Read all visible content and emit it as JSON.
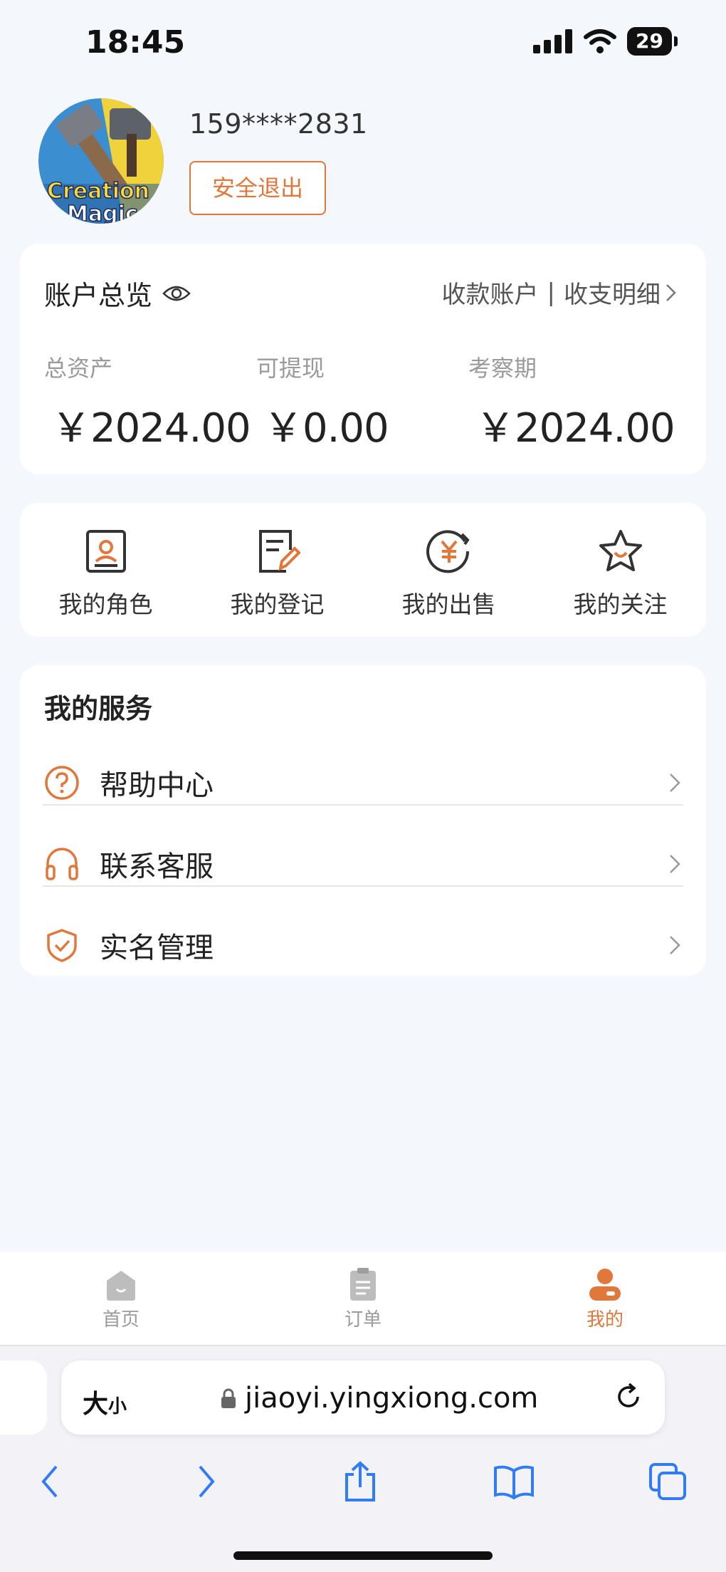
{
  "status_bar": {
    "time": "18:45",
    "battery": "29"
  },
  "profile": {
    "avatar_text_1": "Creation",
    "avatar_text_2": "Magic",
    "phone": "159****2831",
    "logout_label": "安全退出"
  },
  "account": {
    "title": "账户总览",
    "link_receive": "收款账户",
    "separator": "|",
    "link_details": "收支明细",
    "total_label": "总资产",
    "total_value": "￥2024.00",
    "withdraw_label": "可提现",
    "withdraw_value": "￥0.00",
    "review_label": "考察期",
    "review_value": "￥2024.00"
  },
  "quick": [
    {
      "label": "我的角色",
      "icon": "role-icon"
    },
    {
      "label": "我的登记",
      "icon": "register-icon"
    },
    {
      "label": "我的出售",
      "icon": "sale-icon"
    },
    {
      "label": "我的关注",
      "icon": "favorite-star-icon"
    }
  ],
  "services": {
    "title": "我的服务",
    "items": [
      {
        "label": "帮助中心",
        "icon": "help-icon"
      },
      {
        "label": "联系客服",
        "icon": "headset-icon"
      },
      {
        "label": "实名管理",
        "icon": "shield-check-icon"
      }
    ]
  },
  "tabbar": {
    "items": [
      {
        "label": "首页",
        "icon": "home-icon"
      },
      {
        "label": "订单",
        "icon": "orders-icon"
      },
      {
        "label": "我的",
        "icon": "profile-icon"
      }
    ],
    "active": "我的"
  },
  "browser": {
    "text_size_big": "大",
    "text_size_small": "小",
    "url": "jiaoyi.yingxiong.com"
  },
  "colors": {
    "accent": "#e0783c",
    "background": "#f4f7fb",
    "inactive": "#9b9b9b"
  }
}
